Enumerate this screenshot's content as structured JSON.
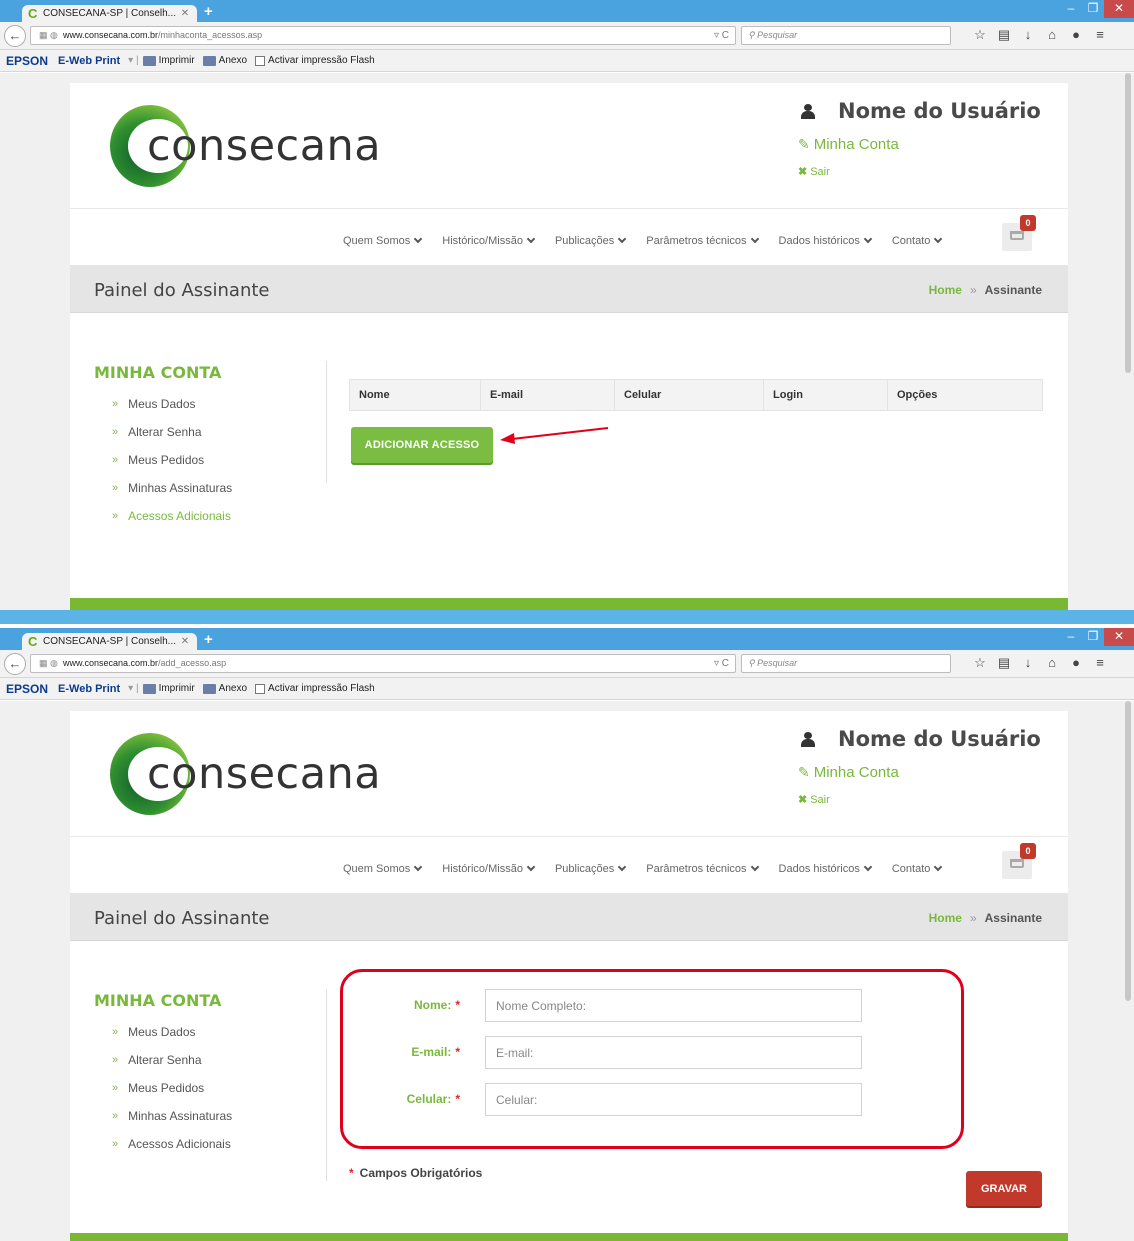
{
  "colors": {
    "brand_green": "#7ab83d",
    "save_red": "#c0392b",
    "annotation_red": "#e0001b",
    "browser_blue": "#4aa3df"
  },
  "screens": [
    {
      "tab_title": "CONSECANA-SP | Conselh...",
      "url_host": "www.consecana.com.br",
      "url_path": "/minhaconta_acessos.asp"
    },
    {
      "tab_title": "CONSECANA-SP | Conselh...",
      "url_host": "www.consecana.com.br",
      "url_path": "/add_acesso.asp"
    }
  ],
  "browser": {
    "search_placeholder": "Pesquisar",
    "toolbar": {
      "epson": "EPSON",
      "ewebprint": "E-Web Print",
      "print": "Imprimir",
      "attach": "Anexo",
      "flash": "Activar impressão Flash"
    }
  },
  "site": {
    "logo_text": "consecana",
    "user_name": "Nome do Usuário",
    "my_account": "Minha Conta",
    "logout": "Sair",
    "menu": [
      "Quem Somos",
      "Histórico/Missão",
      "Publicações",
      "Parâmetros técnicos",
      "Dados históricos",
      "Contato"
    ],
    "cart_count": "0",
    "panel_title": "Painel do Assinante",
    "breadcrumb": {
      "home": "Home",
      "sep": "»",
      "current": "Assinante"
    },
    "sidebar": {
      "title": "MINHA CONTA",
      "items": [
        "Meus Dados",
        "Alterar Senha",
        "Meus Pedidos",
        "Minhas Assinaturas",
        "Acessos Adicionais"
      ]
    }
  },
  "table": {
    "headers": [
      "Nome",
      "E-mail",
      "Celular",
      "Login",
      "Opções"
    ],
    "add_button": "ADICIONAR ACESSO"
  },
  "form": {
    "name_label": "Nome:",
    "name_placeholder": "Nome Completo:",
    "email_label": "E-mail:",
    "email_placeholder": "E-mail:",
    "phone_label": "Celular:",
    "phone_placeholder": "Celular:",
    "required_mark": "*",
    "required_note": "Campos Obrigatórios",
    "save_button": "GRAVAR"
  }
}
